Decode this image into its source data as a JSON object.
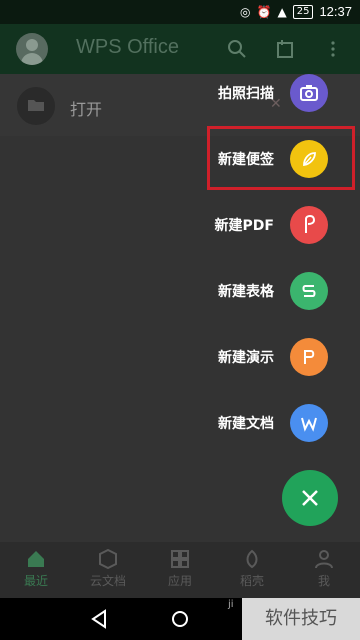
{
  "status_bar": {
    "time": "12:37",
    "battery": "25"
  },
  "app": {
    "title": "WPS Office"
  },
  "recent": {
    "open_label": "打开"
  },
  "menu": [
    {
      "label": "拍照扫描",
      "color": "#6a5acd",
      "icon": "camera-icon"
    },
    {
      "label": "新建便签",
      "color": "#f2c30f",
      "icon": "note-icon"
    },
    {
      "label": "新建PDF",
      "color": "#e84a4a",
      "icon": "pdf-icon"
    },
    {
      "label": "新建表格",
      "color": "#3bb56e",
      "icon": "spreadsheet-icon"
    },
    {
      "label": "新建演示",
      "color": "#f48b3a",
      "icon": "presentation-icon"
    },
    {
      "label": "新建文档",
      "color": "#4a8ff0",
      "icon": "document-icon"
    }
  ],
  "bottom_nav": [
    {
      "label": "最近",
      "icon": "home-icon"
    },
    {
      "label": "云文档",
      "icon": "cloud-doc-icon"
    },
    {
      "label": "应用",
      "icon": "apps-icon"
    },
    {
      "label": "稻壳",
      "icon": "leaf-icon"
    },
    {
      "label": "我",
      "icon": "profile-icon"
    }
  ],
  "watermark": {
    "text": "软件技巧",
    "small": "ji"
  },
  "colors": {
    "accent": "#21a35a",
    "highlight": "#d0202a"
  }
}
